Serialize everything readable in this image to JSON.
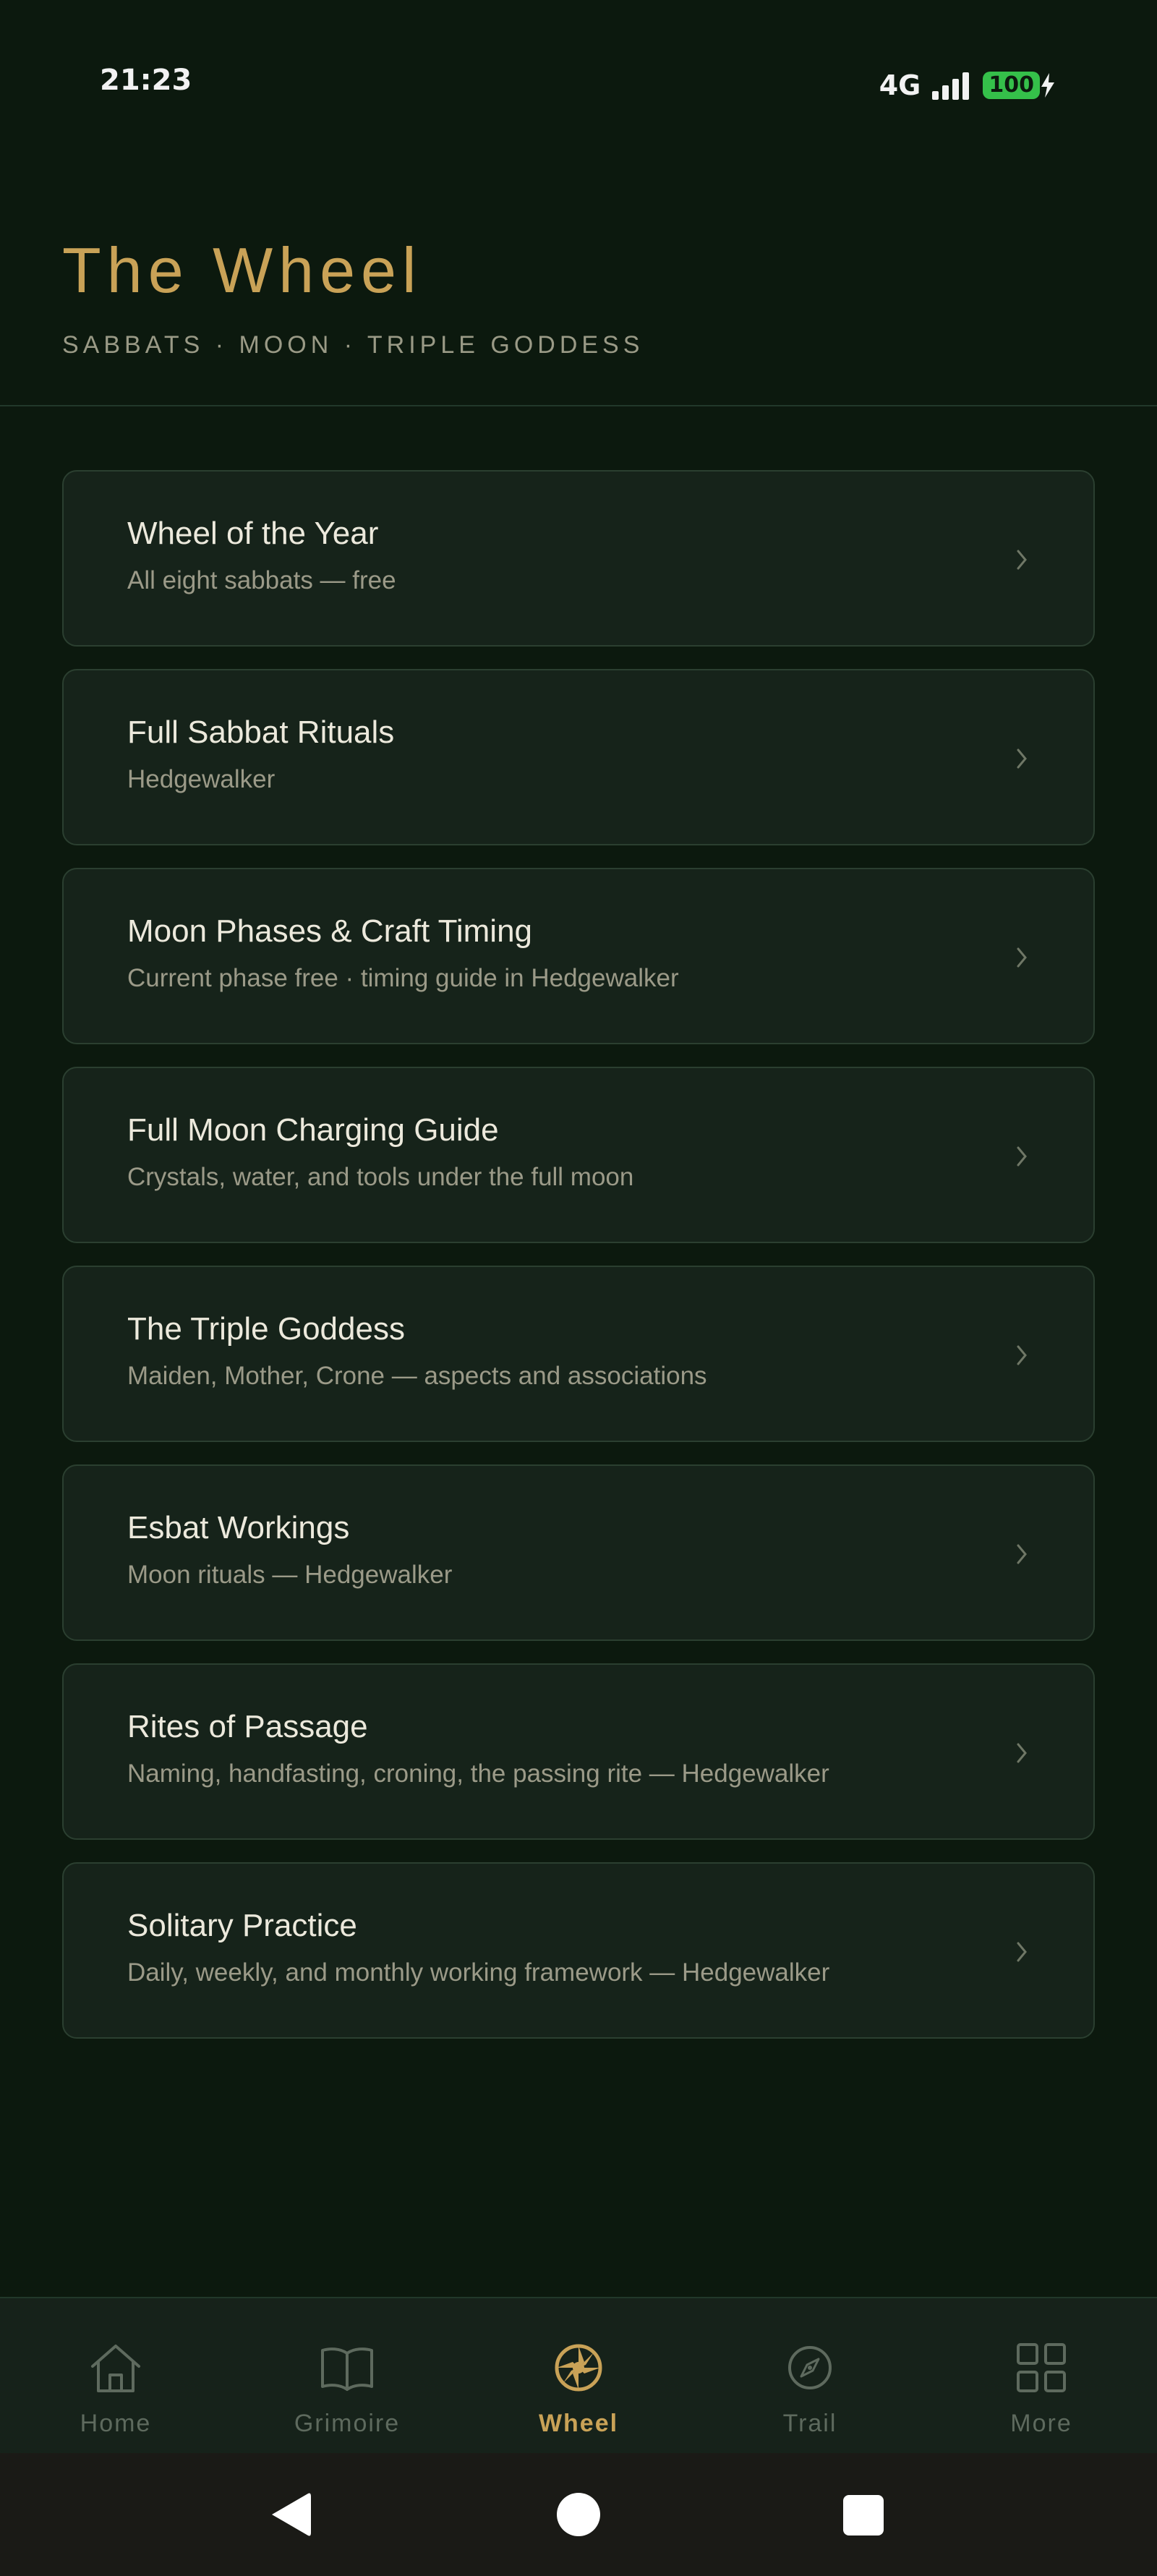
{
  "status_bar": {
    "time": "21:23",
    "network": "4G",
    "battery": "100"
  },
  "header": {
    "title": "The Wheel",
    "subtitle": "SABBATS · MOON · TRIPLE GODDESS"
  },
  "menu": {
    "items": [
      {
        "title": "Wheel of the Year",
        "subtitle": "All eight sabbats — free"
      },
      {
        "title": "Full Sabbat Rituals",
        "subtitle": "Hedgewalker"
      },
      {
        "title": "Moon Phases & Craft Timing",
        "subtitle": "Current phase free · timing guide in Hedgewalker"
      },
      {
        "title": "Full Moon Charging Guide",
        "subtitle": "Crystals, water, and tools under the full moon"
      },
      {
        "title": "The Triple Goddess",
        "subtitle": "Maiden, Mother, Crone — aspects and associations"
      },
      {
        "title": "Esbat Workings",
        "subtitle": "Moon rituals — Hedgewalker"
      },
      {
        "title": "Rites of Passage",
        "subtitle": "Naming, handfasting, croning, the passing rite — Hedgewalker"
      },
      {
        "title": "Solitary Practice",
        "subtitle": "Daily, weekly, and monthly working framework — Hedgewalker"
      }
    ]
  },
  "bottom_nav": {
    "active": "Wheel",
    "items": [
      {
        "label": "Home",
        "icon": "home-icon"
      },
      {
        "label": "Grimoire",
        "icon": "book-icon"
      },
      {
        "label": "Wheel",
        "icon": "wheel-icon"
      },
      {
        "label": "Trail",
        "icon": "compass-icon"
      },
      {
        "label": "More",
        "icon": "grid-icon"
      }
    ]
  },
  "colors": {
    "background": "#0c190e",
    "card": "#16231a",
    "accent_gold": "#c9a257",
    "text_primary": "#ece9dc",
    "text_secondary": "#9b9a88",
    "inactive": "#5e6a5e",
    "battery_green": "#35c04a"
  }
}
